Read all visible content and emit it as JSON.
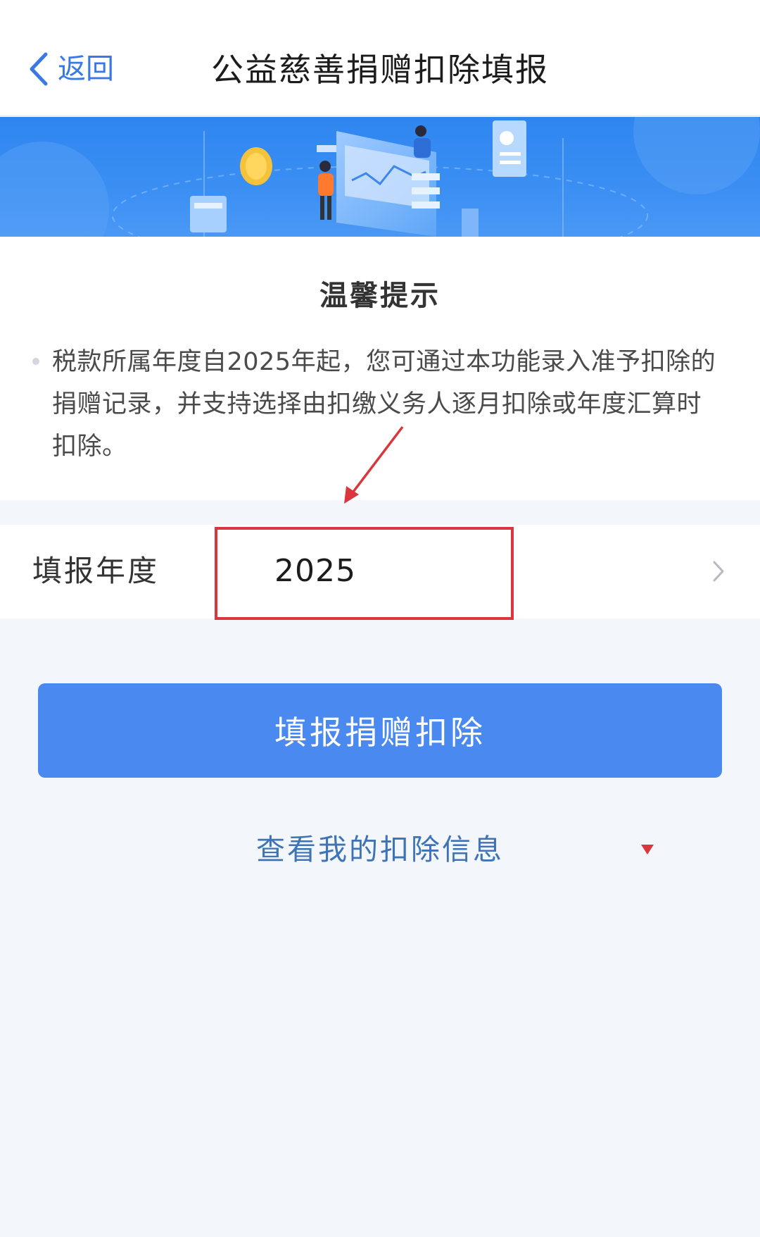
{
  "nav": {
    "back_label": "返回",
    "title": "公益慈善捐赠扣除填报"
  },
  "banner": {
    "illustration": "tax-donation-illustration"
  },
  "tips": {
    "title": "温馨提示",
    "text": "税款所属年度自2025年起，您可通过本功能录入准予扣除的捐赠记录，并支持选择由扣缴义务人逐月扣除或年度汇算时扣除。"
  },
  "year_row": {
    "label": "填报年度",
    "value": "2025"
  },
  "primary_button": {
    "label": "填报捐赠扣除"
  },
  "secondary_link": {
    "label": "查看我的扣除信息"
  },
  "colors": {
    "accent": "#3a78e6",
    "button": "#4a89ef",
    "link": "#3f73b8",
    "annotation": "#d9363e",
    "background": "#f3f6fa"
  },
  "icons": [
    "back-chevron-icon",
    "chevron-right-icon",
    "red-triangle-icon",
    "red-arrow-icon"
  ]
}
